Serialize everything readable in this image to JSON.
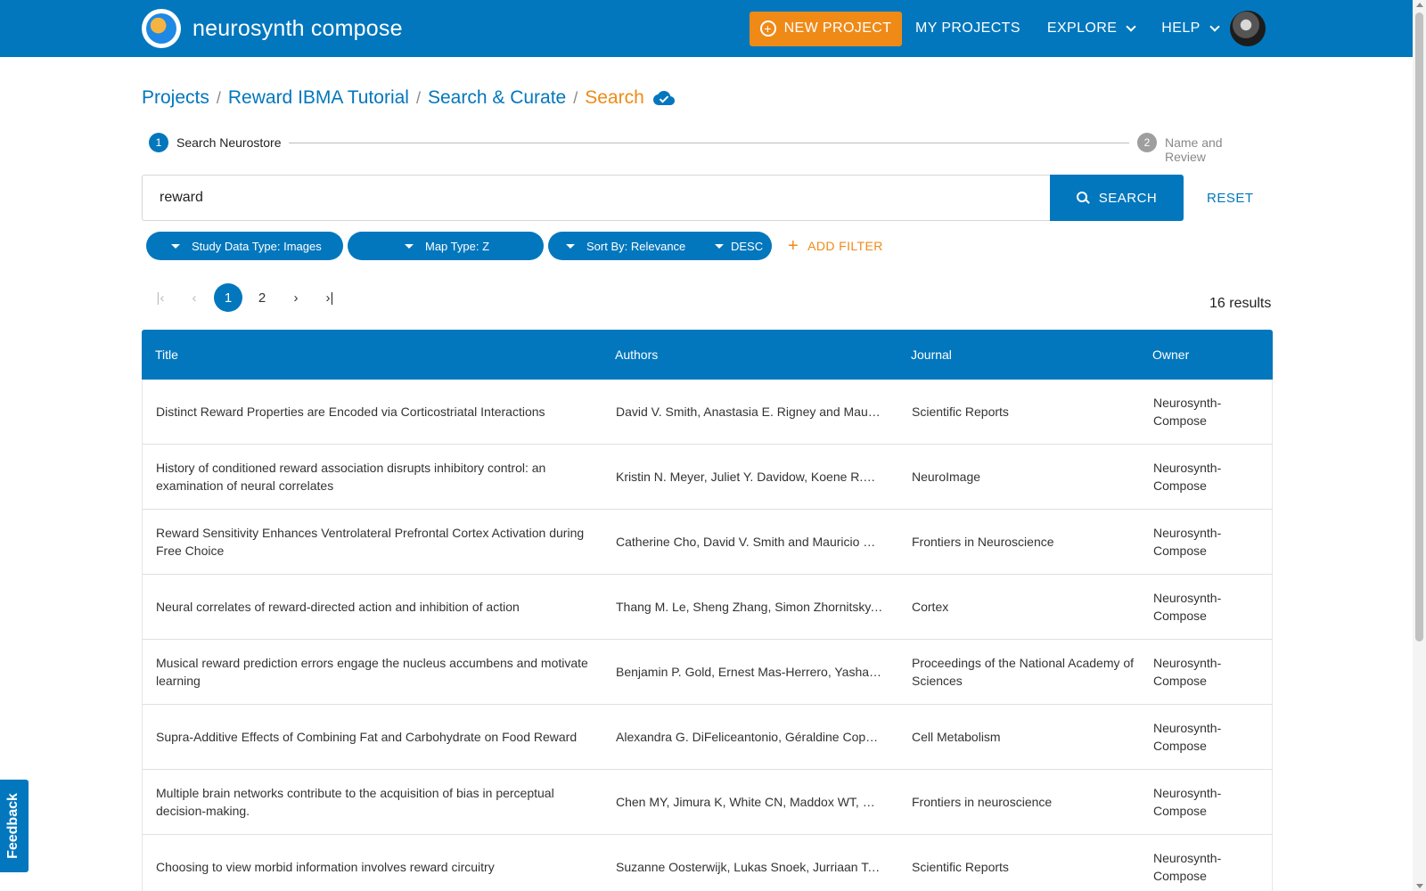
{
  "navbar": {
    "brand": "neurosynth compose",
    "new_project": "NEW PROJECT",
    "my_projects": "MY PROJECTS",
    "explore": "EXPLORE",
    "help": "HELP"
  },
  "breadcrumb": {
    "items": [
      "Projects",
      "Reward IBMA Tutorial",
      "Search & Curate"
    ],
    "current": "Search",
    "separator": "/"
  },
  "stepper": {
    "step1_number": "1",
    "step1_label": "Search Neurostore",
    "step2_number": "2",
    "step2_label": "Name and Review"
  },
  "search": {
    "query": "reward",
    "button": "SEARCH",
    "reset": "RESET"
  },
  "filters": {
    "study_data_type": "Study Data Type: Images",
    "map_type": "Map Type: Z",
    "sort_by": "Sort By: Relevance",
    "order": "DESC",
    "add_filter": "ADD FILTER",
    "add_filter_glyph": "+"
  },
  "pagination": {
    "pages": [
      "1",
      "2"
    ],
    "current": "1",
    "first_glyph": "|‹",
    "prev_glyph": "‹",
    "next_glyph": "›",
    "last_glyph": "›|",
    "results": "16 results"
  },
  "table": {
    "headers": {
      "title": "Title",
      "authors": "Authors",
      "journal": "Journal",
      "owner": "Owner"
    },
    "rows": [
      {
        "title": "Distinct Reward Properties are Encoded via Corticostriatal Interactions",
        "authors": "David V. Smith, Anastasia E. Rigney and Mauricio R. Delgado",
        "journal": "Scientific Reports",
        "owner": "Neurosynth-Compose"
      },
      {
        "title": "History of conditioned reward association disrupts inhibitory control: an examination of neural correlates",
        "authors": "Kristin N. Meyer, Juliet Y. Davidow, Koene R.A. Van Dijk",
        "journal": "NeuroImage",
        "owner": "Neurosynth-Compose"
      },
      {
        "title": "Reward Sensitivity Enhances Ventrolateral Prefrontal Cortex Activation during Free Choice",
        "authors": "Catherine Cho, David V. Smith and Mauricio R. Delgado",
        "journal": "Frontiers in Neuroscience",
        "owner": "Neurosynth-Compose"
      },
      {
        "title": "Neural correlates of reward-directed action and inhibition of action",
        "authors": "Thang M. Le, Sheng Zhang, Simon Zhornitsky, Chiang-shan R. Li",
        "journal": "Cortex",
        "owner": "Neurosynth-Compose"
      },
      {
        "title": "Musical reward prediction errors engage the nucleus accumbens and motivate learning",
        "authors": "Benjamin P. Gold, Ernest Mas-Herrero, Yashar Zeighami",
        "journal": "Proceedings of the National Academy of Sciences",
        "owner": "Neurosynth-Compose"
      },
      {
        "title": "Supra-Additive Effects of Combining Fat and Carbohydrate on Food Reward",
        "authors": "Alexandra G. DiFeliceantonio, Géraldine Coppin, Lionel Rigoux",
        "journal": "Cell Metabolism",
        "owner": "Neurosynth-Compose"
      },
      {
        "title": "Multiple brain networks contribute to the acquisition of bias in perceptual decision-making.",
        "authors": "Chen MY, Jimura K, White CN, Maddox WT, Poldrack RA",
        "journal": "Frontiers in neuroscience",
        "owner": "Neurosynth-Compose"
      },
      {
        "title": "Choosing to view morbid information involves reward circuitry",
        "authors": "Suzanne Oosterwijk, Lukas Snoek, Jurriaan Tekoppele",
        "journal": "Scientific Reports",
        "owner": "Neurosynth-Compose"
      }
    ]
  },
  "feedback": "Feedback",
  "colors": {
    "primary": "#0277bd",
    "accent": "#ef8a17"
  }
}
